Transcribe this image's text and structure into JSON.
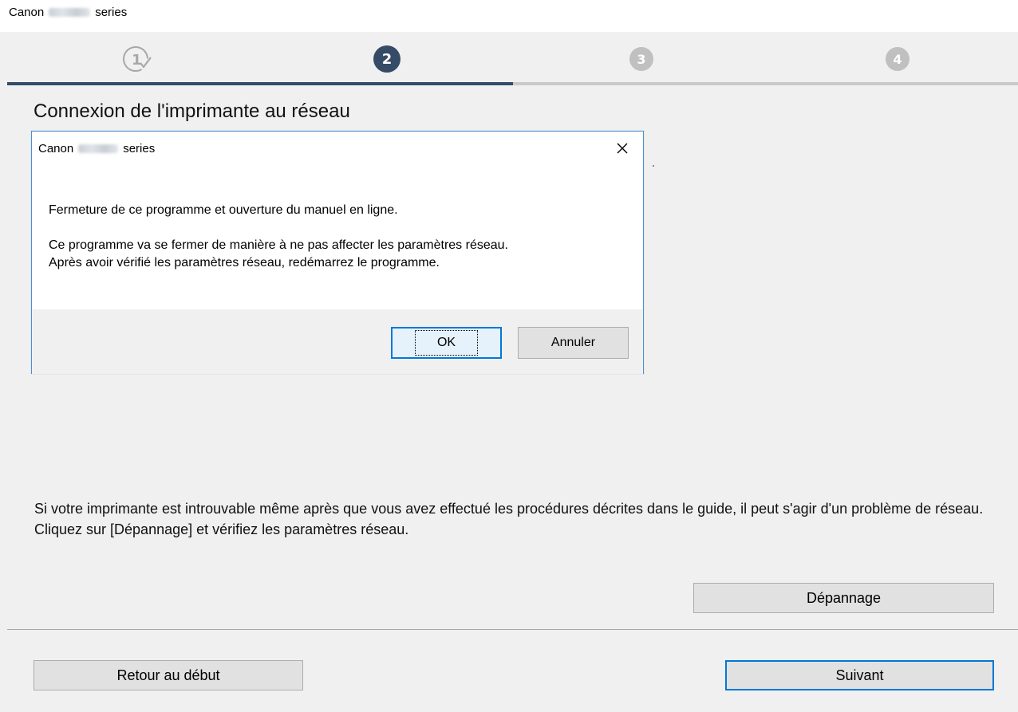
{
  "window": {
    "title_prefix": "Canon",
    "title_suffix": "series"
  },
  "steps": [
    {
      "label": "1",
      "state": "completed"
    },
    {
      "label": "2",
      "state": "current"
    },
    {
      "label": "3",
      "state": "pending"
    },
    {
      "label": "4",
      "state": "pending"
    }
  ],
  "progress": {
    "fraction": 0.5
  },
  "main": {
    "title": "Connexion de l'imprimante au réseau",
    "info_text": "Si votre imprimante est introuvable même après que vous avez effectué les procédures décrites dans le guide, il peut s'agir d'un problème de réseau. Cliquez sur [Dépannage] et vérifiez les paramètres réseau.",
    "troubleshoot_label": "Dépannage"
  },
  "dialog": {
    "title_prefix": "Canon",
    "title_suffix": "series",
    "message_line1": "Fermeture de ce programme et ouverture du manuel en ligne.",
    "message_line2": "Ce programme va se fermer de manière à ne pas affecter les paramètres réseau.",
    "message_line3": "Après avoir vérifié les paramètres réseau, redémarrez le programme.",
    "ok_label": "OK",
    "cancel_label": "Annuler"
  },
  "footer": {
    "back_label": "Retour au début",
    "next_label": "Suivant"
  },
  "colors": {
    "accent": "#354b66",
    "focus_border": "#0078d7",
    "pending_step": "#c0c0c0"
  },
  "icons": {
    "close": "close-icon",
    "completed_step": "checkmark-icon"
  }
}
